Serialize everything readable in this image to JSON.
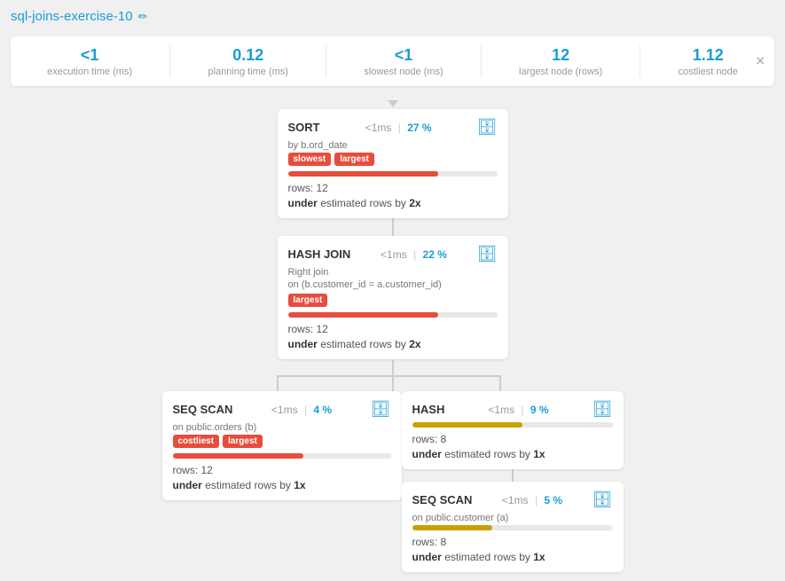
{
  "header": {
    "title": "sql-joins-exercise-10",
    "edit_icon": "✏"
  },
  "stats": {
    "execution_time_value": "<1",
    "execution_time_label": "execution time (ms)",
    "planning_time_value": "0.12",
    "planning_time_label": "planning time (ms)",
    "slowest_node_value": "<1",
    "slowest_node_label": "slowest node (ms)",
    "largest_node_value": "12",
    "largest_node_label": "largest node (rows)",
    "costliest_node_value": "1.12",
    "costliest_node_label": "costliest node"
  },
  "nodes": {
    "sort": {
      "title": "SORT",
      "timing": "<1ms",
      "pct": "27 %",
      "subtitle": "by b.ord_date",
      "badges": [
        "slowest",
        "largest"
      ],
      "progress": 72,
      "rows": "rows: 12",
      "under": "under",
      "estimated": "estimated rows by",
      "multiplier": "2x"
    },
    "hash_join": {
      "title": "HASH JOIN",
      "timing": "<1ms",
      "pct": "22 %",
      "subtitle": "Right join",
      "subtitle2": "on (b.customer_id = a.customer_id)",
      "badges": [
        "largest"
      ],
      "progress": 72,
      "rows": "rows: 12",
      "under": "under",
      "estimated": "estimated rows by",
      "multiplier": "2x"
    },
    "seq_scan": {
      "title": "SEQ SCAN",
      "timing": "<1ms",
      "pct": "4 %",
      "subtitle": "on public.orders (b)",
      "badges": [
        "costliest",
        "largest"
      ],
      "progress": 60,
      "rows": "rows: 12",
      "under": "under",
      "estimated": "estimated rows by",
      "multiplier": "1x"
    },
    "hash": {
      "title": "HASH",
      "timing": "<1ms",
      "pct": "9 %",
      "progress": 55,
      "rows": "rows: 8",
      "under": "under",
      "estimated": "estimated rows by",
      "multiplier": "1x"
    },
    "seq_scan2": {
      "title": "SEQ SCAN",
      "timing": "<1ms",
      "pct": "5 %",
      "subtitle": "on public.customer (a)",
      "progress": 40,
      "rows": "rows: 8",
      "under": "under",
      "estimated": "estimated rows by",
      "multiplier": "1x"
    }
  }
}
